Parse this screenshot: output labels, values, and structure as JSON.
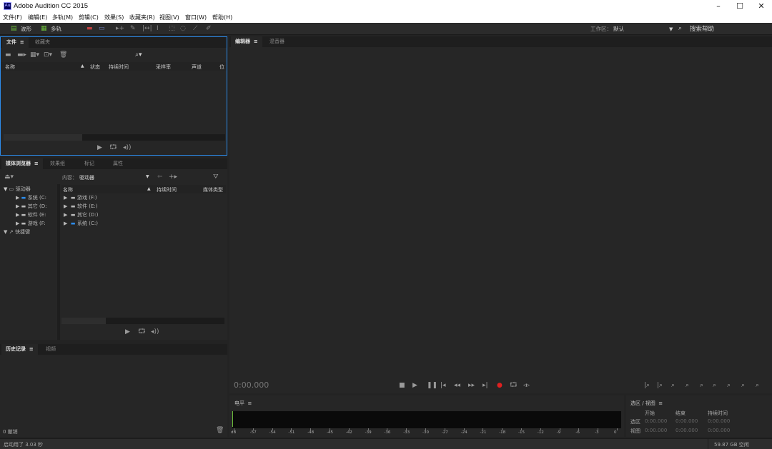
{
  "window": {
    "title": "Adobe Audition CC 2015",
    "icon_text": "Au",
    "minimize": "–",
    "maximize": "☐",
    "close": "✕"
  },
  "menu": [
    "文件(F)",
    "编辑(E)",
    "多轨(M)",
    "剪辑(C)",
    "效果(S)",
    "收藏夹(R)",
    "视图(V)",
    "窗口(W)",
    "帮助(H)"
  ],
  "toolbar": {
    "waveform": "波形",
    "multitrack": "多轨",
    "workspace_label": "工作区：",
    "workspace_value": "默认",
    "search_help": "搜索帮助"
  },
  "files_panel": {
    "tabs": [
      "文件",
      "收藏夹"
    ],
    "columns": [
      "名称",
      "状态",
      "持续时间",
      "采样率",
      "声道",
      "位"
    ]
  },
  "media_browser": {
    "tabs": [
      "媒体浏览器",
      "效果组",
      "标记",
      "属性"
    ],
    "contents_label": "内容：",
    "contents_value": "驱动器",
    "tree": [
      {
        "label": "驱动器",
        "level": 0
      },
      {
        "label": "系统 (C:",
        "level": 1
      },
      {
        "label": "其它 (D:",
        "level": 1
      },
      {
        "label": "软件 (E:",
        "level": 1
      },
      {
        "label": "游戏 (F:",
        "level": 1
      },
      {
        "label": "快捷键",
        "level": 0
      }
    ],
    "columns": [
      "名称",
      "持续时间",
      "媒体类型"
    ],
    "items": [
      "游戏 (F:)",
      "软件 (E:)",
      "其它 (D:)",
      "系统 (C:)"
    ]
  },
  "history_panel": {
    "tabs": [
      "历史记录",
      "视频"
    ],
    "undo_count": "0 撤销"
  },
  "editor": {
    "tabs": [
      "编辑器",
      "混音器"
    ],
    "timecode": "0:00.000"
  },
  "level_panel": {
    "title": "电平",
    "scale": [
      "dB",
      "-57",
      "-54",
      "-51",
      "-48",
      "-45",
      "-42",
      "-39",
      "-36",
      "-33",
      "-30",
      "-27",
      "-24",
      "-21",
      "-18",
      "-15",
      "-12",
      "-9",
      "-6",
      "-3",
      "0"
    ]
  },
  "selection_panel": {
    "title": "选区 / 视图",
    "columns": [
      "开始",
      "结束",
      "持续时间"
    ],
    "rows": [
      {
        "label": "选区",
        "start": "0:00.000",
        "end": "0:00.000",
        "duration": "0:00.000"
      },
      {
        "label": "视图",
        "start": "0:00.000",
        "end": "0:00.000",
        "duration": "0:00.000"
      }
    ]
  },
  "status": {
    "left": "启动用了 3.03 秒",
    "right": "59.87 GB 空闲"
  },
  "colors": {
    "accent": "#2d8ceb",
    "record": "#e02020",
    "meter_green": "#6dbf3b"
  }
}
